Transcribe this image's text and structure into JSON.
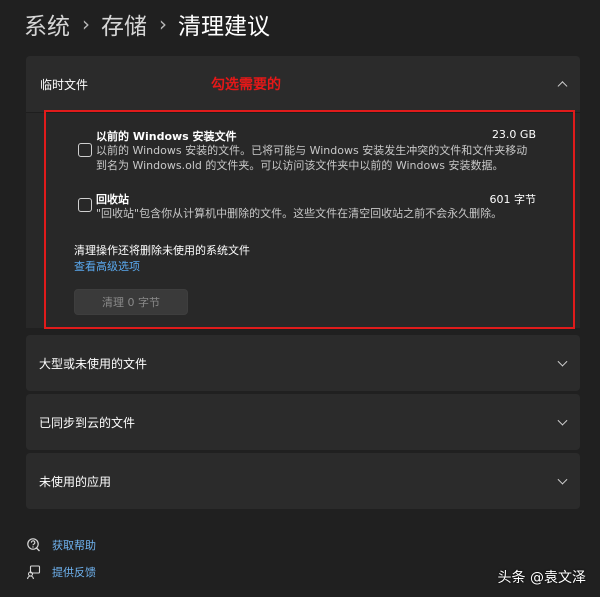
{
  "breadcrumb": {
    "items": [
      "系统",
      "存储",
      "清理建议"
    ],
    "separator": "›"
  },
  "temp_files": {
    "title": "临时文件",
    "annotation": "勾选需要的",
    "items": [
      {
        "title": "以前的 Windows 安装文件",
        "size": "23.0 GB",
        "description": "以前的 Windows 安装的文件。已将可能与 Windows 安装发生冲突的文件和文件夹移动到名为 Windows.old 的文件夹。可以访问该文件夹中以前的 Windows 安装数据。",
        "checked": false
      },
      {
        "title": "回收站",
        "size": "601 字节",
        "description": "\"回收站\"包含你从计算机中删除的文件。这些文件在清空回收站之前不会永久删除。",
        "checked": false
      }
    ],
    "note": "清理操作还将删除未使用的系统文件",
    "advanced_link": "查看高级选项",
    "clean_button": "清理 0 字节"
  },
  "sections": [
    {
      "title": "大型或未使用的文件"
    },
    {
      "title": "已同步到云的文件"
    },
    {
      "title": "未使用的应用"
    }
  ],
  "footer": {
    "help": "获取帮助",
    "feedback": "提供反馈"
  },
  "watermark": "头条 @袁文泽",
  "colors": {
    "background": "#202020",
    "panel": "#2b2b2b",
    "link": "#5aa9ef",
    "annotation_red": "#e01b1b"
  }
}
